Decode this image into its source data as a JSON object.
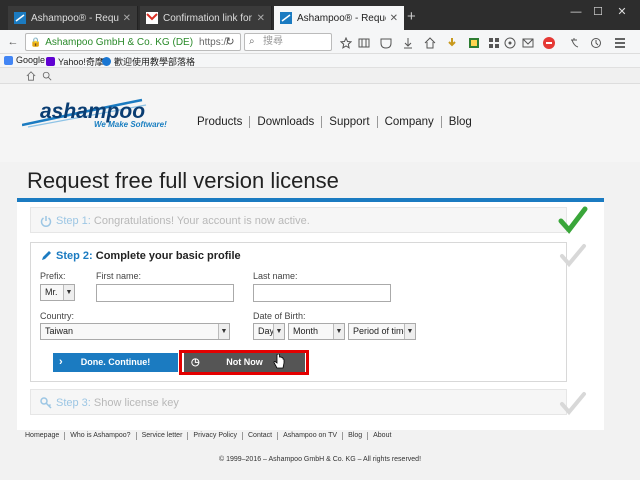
{
  "browser": {
    "tabs": [
      {
        "title": "Ashampoo® - Request f...",
        "active": false
      },
      {
        "title": "Confirmation link for yo...",
        "active": false
      },
      {
        "title": "Ashampoo® - Request f...",
        "active": true
      }
    ],
    "address": {
      "site_identity": "Ashampoo GmbH & Co. KG (DE)",
      "url": "https://"
    },
    "search_placeholder": "搜尋",
    "bookmarks": [
      "Google",
      "Yahoo!奇摩",
      "歡迎使用教學部落格"
    ]
  },
  "site": {
    "logo_word": "ashampoo",
    "logo_tagline": "We Make Software!",
    "nav": [
      "Products",
      "Downloads",
      "Support",
      "Company",
      "Blog"
    ]
  },
  "page": {
    "title": "Request free full version license",
    "step1": {
      "number": "Step 1:",
      "text": "Congratulations! Your account is now active.",
      "complete": true
    },
    "step2": {
      "number": "Step 2:",
      "text": "Complete your basic profile",
      "prefix_label": "Prefix:",
      "prefix_value": "Mr.",
      "first_name_label": "First name:",
      "first_name_value": "",
      "last_name_label": "Last name:",
      "last_name_value": "",
      "country_label": "Country:",
      "country_value": "Taiwan",
      "dob_label": "Date of Birth:",
      "dob_day": "Day",
      "dob_month": "Month",
      "dob_period": "Period of time",
      "continue_button": "Done. Continue!",
      "not_now_button": "Not Now"
    },
    "step3": {
      "number": "Step 3:",
      "text": "Show license key"
    }
  },
  "footer": {
    "links": [
      "Homepage",
      "Who is Ashampoo?",
      "Service letter",
      "Privacy Policy",
      "Contact",
      "Ashampoo on TV",
      "Blog",
      "About"
    ],
    "copyright": "© 1999–2016 – Ashampoo GmbH & Co. KG – All rights reserved!"
  },
  "colors": {
    "accent": "#1b7bc1",
    "check_done": "#3aa63a",
    "check_pending": "#d8d8d8",
    "highlight": "#e30000"
  }
}
